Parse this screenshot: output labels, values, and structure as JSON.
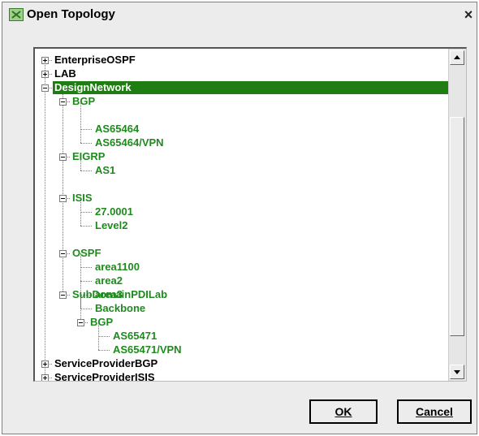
{
  "window": {
    "title": "Open Topology",
    "close_label": "×"
  },
  "colors": {
    "tree_text": "#1e8a1e",
    "selection": "#1f7d14",
    "dialog_bg": "#ececec"
  },
  "tree": [
    {
      "label": "EnterpriseOSPF",
      "expanded": false
    },
    {
      "label": "LAB",
      "expanded": false
    },
    {
      "label": "DesignNetwork",
      "expanded": true,
      "selected": true
    },
    {
      "label": "BGP",
      "expanded": true
    },
    {
      "label": "AS65464"
    },
    {
      "label": "AS65464/VPN"
    },
    {
      "label": "EIGRP",
      "expanded": true
    },
    {
      "label": "AS1"
    },
    {
      "label": "ISIS",
      "expanded": true
    },
    {
      "label": "27.0001"
    },
    {
      "label": "Level2"
    },
    {
      "label": "OSPF",
      "expanded": true
    },
    {
      "label": "area1100"
    },
    {
      "label": "area2"
    },
    {
      "label": "area3"
    },
    {
      "label": "Backbone"
    },
    {
      "label": "SubDomainPDILab",
      "expanded": true
    },
    {
      "label": "BGP",
      "expanded": true
    },
    {
      "label": "AS65471"
    },
    {
      "label": "AS65471/VPN"
    },
    {
      "label": "ServiceProviderBGP",
      "expanded": false
    },
    {
      "label": "ServiceProviderISIS",
      "expanded": false
    }
  ],
  "scroll": {
    "up_icon": "scroll-up-arrow",
    "down_icon": "scroll-down-arrow"
  },
  "buttons": {
    "ok": "OK",
    "cancel": "Cancel"
  }
}
